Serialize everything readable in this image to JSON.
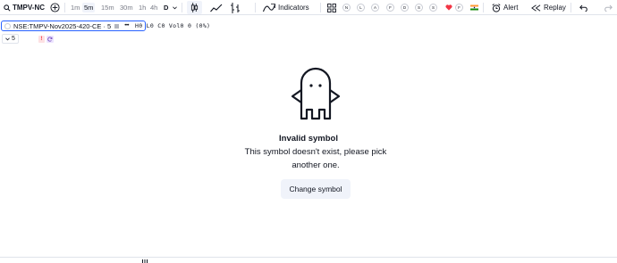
{
  "toolbar": {
    "symbol": "TMPV-NC",
    "add_symbol_label": "+",
    "intervals": [
      "1m",
      "5m",
      "15m",
      "30m",
      "1h",
      "4h",
      "D"
    ],
    "active_interval": "5m",
    "indicators_label": "Indicators",
    "quick_buttons": [
      "N",
      "L",
      "A",
      "F",
      "D",
      "S",
      "S",
      "F"
    ],
    "alert_label": "Alert",
    "replay_label": "Replay"
  },
  "legend": {
    "title": "NSE:TMPV-Nov2025-420-CE · 5",
    "more": "•••",
    "ohlc": "H0 L0 C0 Vol0 0 (0%)"
  },
  "sub_legend": {
    "collapse_count": "5",
    "excl": "!"
  },
  "error": {
    "title": "Invalid symbol",
    "message": "This symbol doesn't exist, please pick another one.",
    "button_label": "Change symbol"
  },
  "colors": {
    "accent": "#2962ff",
    "text": "#131722",
    "muted": "#787b86",
    "button_bg": "#f0f3fa",
    "heart": "#f23645"
  }
}
